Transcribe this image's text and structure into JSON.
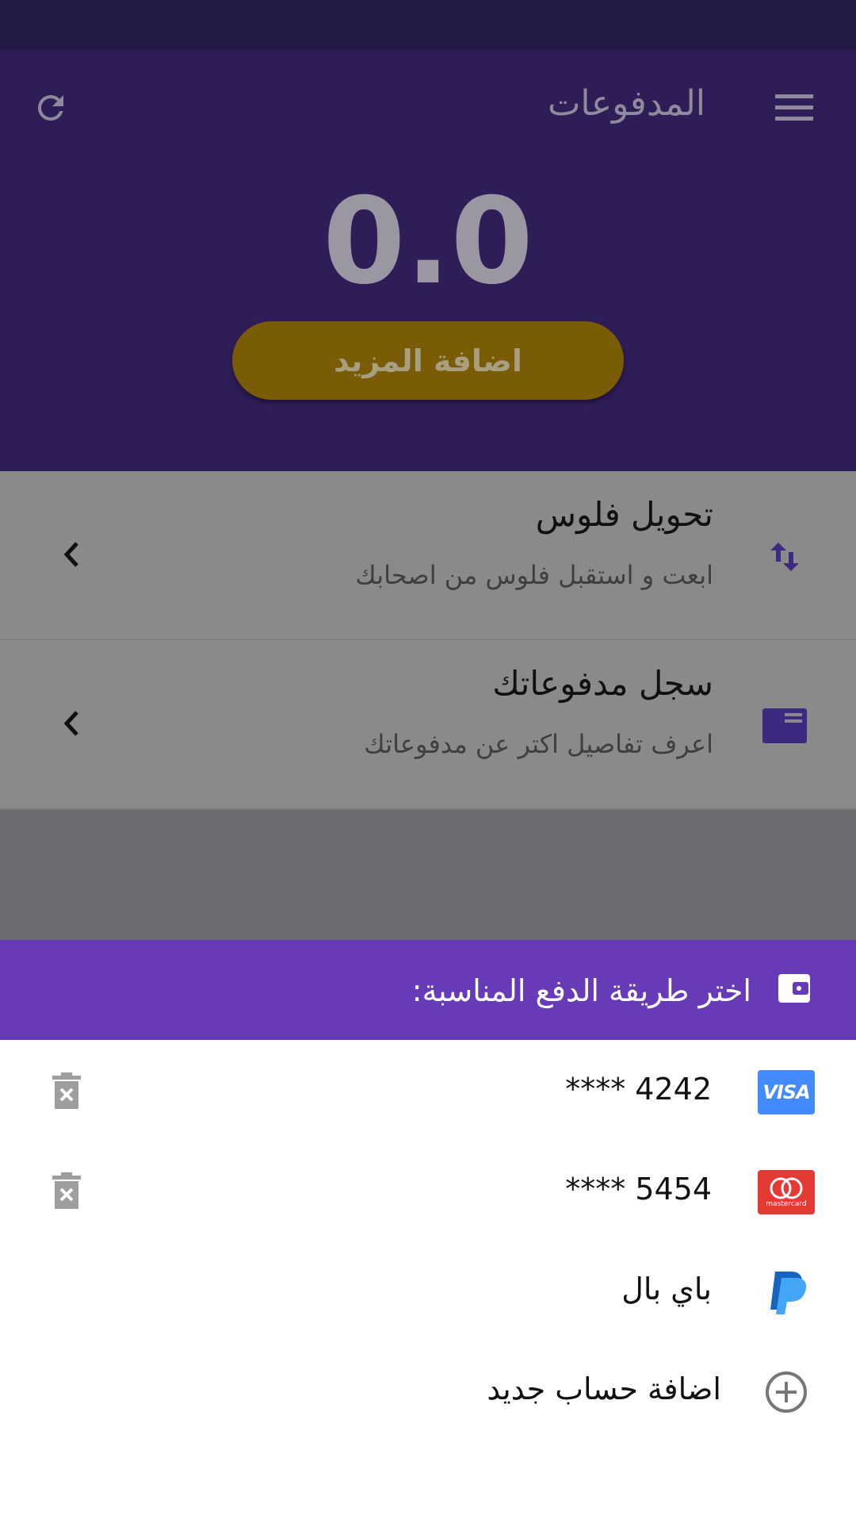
{
  "colors": {
    "status_bar": "#241b45",
    "app_bar": "#2f1d57",
    "accent_button": "#7a5c07",
    "sheet_header": "#673ab7",
    "visa": "#448aff",
    "mastercard": "#e53935",
    "paypal": "#2196f3"
  },
  "header": {
    "title": "المدفوعات",
    "refresh_icon": "refresh-icon",
    "menu_icon": "menu-icon"
  },
  "balance": {
    "amount": "0.0",
    "add_more_label": "اضافة المزيد"
  },
  "menu_items": [
    {
      "title": "تحويل فلوس",
      "subtitle": "ابعت و استقبل فلوس من اصحابك",
      "icon": "swap-vertical-icon"
    },
    {
      "title": "سجل مدفوعاتك",
      "subtitle": "اعرف تفاصيل اكتر عن مدفوعاتك",
      "icon": "receipt-icon"
    }
  ],
  "payment_sheet": {
    "title": "اختر طريقة الدفع المناسبة:",
    "icon": "wallet-icon",
    "methods": [
      {
        "label": "**** 4242",
        "icon": "visa-icon"
      },
      {
        "label": "**** 5454",
        "icon": "mastercard-icon"
      },
      {
        "label": "باي بال",
        "icon": "paypal-icon"
      },
      {
        "label": "اضافة حساب جديد",
        "icon": "add-circle-icon"
      }
    ],
    "visa_text": "VISA",
    "mastercard_text": "mastercard"
  }
}
